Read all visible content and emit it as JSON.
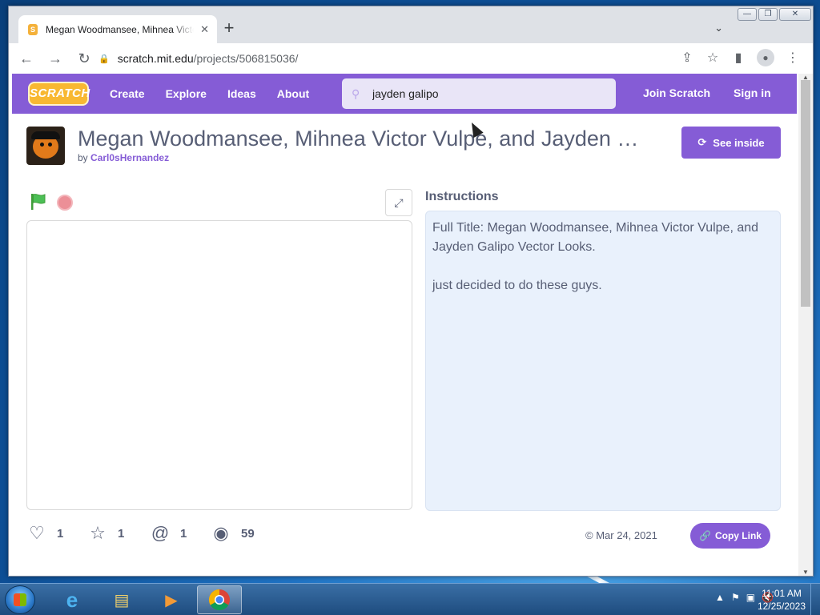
{
  "browser": {
    "tab_title": "Megan Woodmansee, Mihnea Victor Vulpe, and Jayden Galipo Vector Looks on Scratch",
    "tab_close": "✕",
    "new_tab": "+",
    "url_host": "scratch.mit.edu",
    "url_path": "/projects/506815036/",
    "window_controls": [
      "—",
      "❐",
      "✕"
    ]
  },
  "scratch_nav": {
    "logo": "SCRATCH",
    "links": [
      "Create",
      "Explore",
      "Ideas",
      "About"
    ],
    "search_value": "jayden galipo",
    "join": "Join Scratch",
    "signin": "Sign in"
  },
  "project": {
    "title": "Megan Woodmansee, Mihnea Victor Vulpe, and Jayden Galipo Vector Looks",
    "by_prefix": "by",
    "author": "Carl0sHernandez",
    "see_inside": "See inside",
    "instructions_label": "Instructions",
    "instructions": [
      "Full Title: Megan Woodmansee, Mihnea Victor Vulpe, and Jayden Galipo Vector Looks.",
      "just decided to do these guys."
    ],
    "stats": {
      "loves": "1",
      "favorites": "1",
      "remixes": "1",
      "views": "59"
    },
    "date": "Mar 24, 2021",
    "copy_link": "Copy Link"
  },
  "taskbar": {
    "time": "11:01 AM",
    "date": "12/25/2023"
  },
  "colors": {
    "scratch_purple": "#855cd6",
    "instructions_bg": "#e9f1fc",
    "text": "#575e75"
  }
}
